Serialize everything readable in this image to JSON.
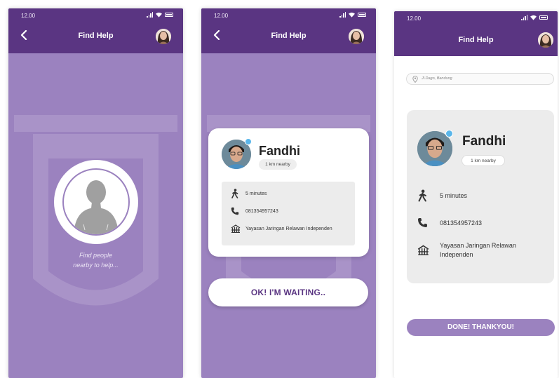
{
  "status_time": "12.00",
  "header_title": "Find Help",
  "screen1": {
    "find_text_line1": "Find people",
    "find_text_line2": "nearby to help..."
  },
  "helper": {
    "name": "Fandhi",
    "distance": "1 km nearby",
    "eta": "5 minutes",
    "phone": "081354957243",
    "organization": "Yayasan Jaringan Relawan Independen",
    "org_line1": "Yayasan Jaringan Relawan",
    "org_line2": "Independen"
  },
  "screen2": {
    "button_label": "OK! I'M WAITING.."
  },
  "screen3": {
    "location": "Jl.Dago, Bandung",
    "button_label": "DONE! THANKYOU!"
  },
  "colors": {
    "header": "#5a3582",
    "background": "#9b82bf",
    "accent_text": "#5a3582",
    "verified": "#5ab6ea"
  },
  "icons": [
    "back-arrow-icon",
    "signal-icon",
    "wifi-icon",
    "battery-icon",
    "walking-person-icon",
    "phone-icon",
    "building-icon",
    "location-pin-icon",
    "verified-check-icon"
  ]
}
